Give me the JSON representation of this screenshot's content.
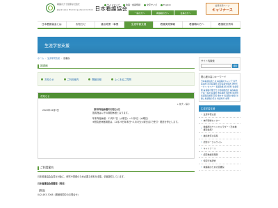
{
  "header": {
    "logo_tagline": "看護の力で健康な社会を",
    "logo_org_en": "Japanese Nursing Association",
    "logo_name": "日本看護協会",
    "util_links": [
      "サイトマップ",
      "会員・会員登録",
      "文字サイズ",
      "English"
    ],
    "buttons": [
      "一般の方へ",
      "看護職の方へ",
      "会員の方へ"
    ],
    "cta_top": "会員専用ページ",
    "cta_main": "キャリナース"
  },
  "gnav": {
    "items": [
      "日本看護協会とは",
      "お知らせ",
      "重点政策・事業",
      "生涯学習支援",
      "看護実践情報",
      "看護職の方へ",
      "看護統計資料"
    ],
    "active_index": 3
  },
  "banner": {
    "title": "生涯学習支援"
  },
  "breadcrumb": {
    "items": [
      "ホーム",
      "生涯学習支援",
      "図書館"
    ]
  },
  "main": {
    "section_title": "図書館",
    "tabs": [
      "お知らせ",
      "ご利用案内",
      "開館日程",
      "よくあるご質問"
    ],
    "notice": {
      "head": "お知らせ",
      "tools": "+ 拡大 - 縮小",
      "date": "2022年12月9日",
      "title": "【年末年始休館のお知らせ】",
      "line1": "図書館は以下の期間休館となります。",
      "line2": "年末年始休館：12月27日（火曜日）～1月5日（木曜日）",
      "line3": "※閲覧室休館期間は、12月29日年末日～1月3日(火曜日)まで受付・発送を停止します。"
    },
    "usage": {
      "title": "ご利用案内",
      "p1": "日本看護協会会員を対象に、研究や業務のため必要な資料を収集、情報提供しています。",
      "p2": "日本看護協会図書館（現況）",
      "p3": "【電話】",
      "p4": "042-493-7008（開館時間中のお問合せ）"
    }
  },
  "side": {
    "search_head": "サイト内検索",
    "search_button": "検索",
    "keywords_head": "関心度の高いキーワード",
    "keywords": "日本看護協会とは 看護職のキャリア 専門看護師 認定看護師 認定看護管理者 研修ポータル セミナー 看護政策 統計資料 社会保険 看護職の働き方 診療報酬改定 病院看護 介護・福祉 看護師 准看護師 保健師 助産師 看護職員確保 定着 働き方 看護職の健康 労働と看護職の安全 看護教育 倫理",
    "nav_head": "生涯学習支援",
    "nav_items": [
      "生涯学習支援",
      "神戸研修センター",
      "看護師のクリニカルラダー（日本看護協会版）",
      "継続教育の基準",
      "研修ポータルサイト",
      "キャリナース",
      "認定看護管理者",
      "特定行為研修",
      "看護職のための図書館"
    ]
  }
}
